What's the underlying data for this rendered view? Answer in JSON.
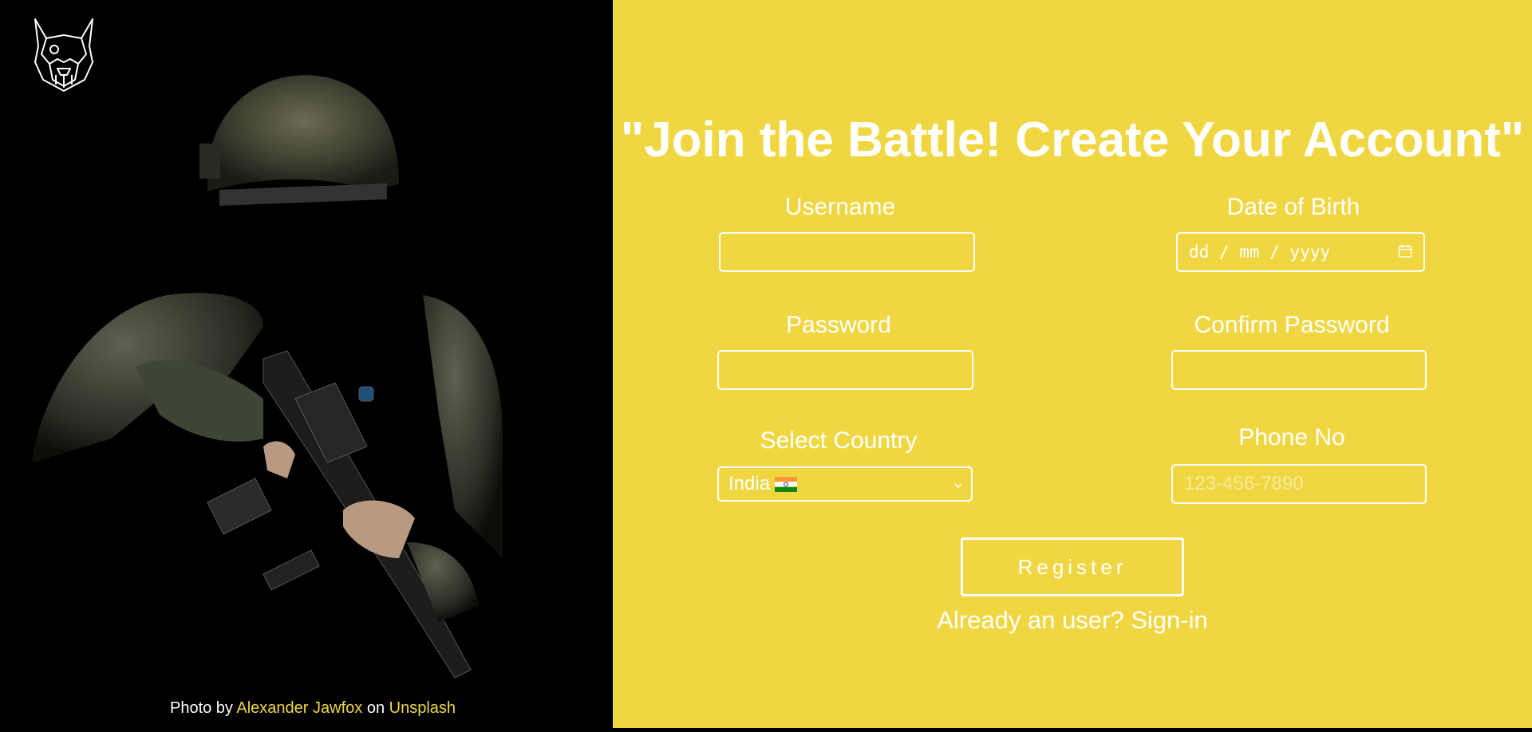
{
  "page": {
    "accent_color": "#f0d742",
    "text_color": "#ffffff",
    "background_left": "#000000"
  },
  "logo": {
    "icon": "dog-head-logo-icon"
  },
  "photo": {
    "icon": "soldier-photo",
    "credit_prefix": "Photo by ",
    "author": "Alexander Jawfox",
    "credit_middle": " on ",
    "source": "Unsplash"
  },
  "form": {
    "title": "\"Join the Battle! Create Your Account\"",
    "username": {
      "label": "Username",
      "value": ""
    },
    "dob": {
      "label": "Date of Birth",
      "placeholder": "dd / mm / yyyy",
      "icon": "calendar-icon"
    },
    "password": {
      "label": "Password",
      "value": ""
    },
    "confirm_password": {
      "label": "Confirm Password",
      "value": ""
    },
    "country": {
      "label": "Select Country",
      "selected": "India",
      "flag": "india-flag-icon"
    },
    "phone": {
      "label": "Phone No",
      "placeholder": "123-456-7890"
    },
    "register_label": "Register",
    "signin_text": "Already an user? Sign-in"
  }
}
